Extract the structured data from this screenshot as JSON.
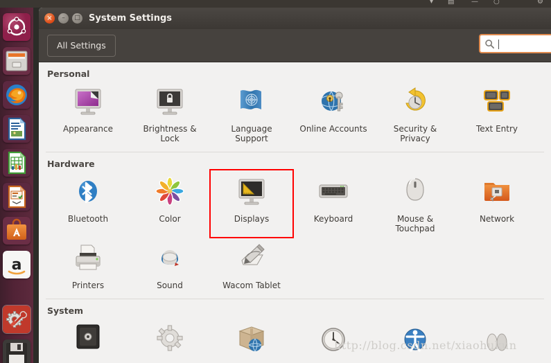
{
  "top_panel": {
    "indicators": [
      "chevron-down",
      "battery",
      "keyboard-layout",
      "clock",
      "power-gear"
    ]
  },
  "launcher": {
    "items": [
      {
        "name": "ubuntu-dash",
        "label": "Ubuntu Dash",
        "active": false
      },
      {
        "name": "files",
        "label": "Files",
        "active": false
      },
      {
        "name": "firefox",
        "label": "Firefox Web Browser",
        "active": false
      },
      {
        "name": "libreoffice-writer",
        "label": "LibreOffice Writer",
        "active": false
      },
      {
        "name": "libreoffice-calc",
        "label": "LibreOffice Calc",
        "active": false
      },
      {
        "name": "libreoffice-impress",
        "label": "LibreOffice Impress",
        "active": false
      },
      {
        "name": "ubuntu-software-center",
        "label": "Ubuntu Software Center",
        "active": false
      },
      {
        "name": "amazon",
        "label": "Amazon",
        "active": false
      },
      {
        "name": "system-settings",
        "label": "System Settings",
        "active": true
      },
      {
        "name": "disk-drive",
        "label": "Disk",
        "active": false
      }
    ]
  },
  "window": {
    "title": "System Settings",
    "controls": {
      "close": "×",
      "minimize": "–",
      "maximize": "□"
    },
    "toolbar": {
      "all_settings_label": "All Settings",
      "search_value": "",
      "search_placeholder": ""
    }
  },
  "sections": [
    {
      "title": "Personal",
      "items": [
        {
          "label": "Appearance",
          "icon": "appearance-icon",
          "highlight": false
        },
        {
          "label": "Brightness & Lock",
          "icon": "brightness-lock-icon",
          "highlight": false
        },
        {
          "label": "Language Support",
          "icon": "language-support-icon",
          "highlight": false
        },
        {
          "label": "Online Accounts",
          "icon": "online-accounts-icon",
          "highlight": false
        },
        {
          "label": "Security & Privacy",
          "icon": "security-privacy-icon",
          "highlight": false
        },
        {
          "label": "Text Entry",
          "icon": "text-entry-icon",
          "highlight": false
        }
      ]
    },
    {
      "title": "Hardware",
      "items": [
        {
          "label": "Bluetooth",
          "icon": "bluetooth-icon",
          "highlight": false
        },
        {
          "label": "Color",
          "icon": "color-icon",
          "highlight": false
        },
        {
          "label": "Displays",
          "icon": "displays-icon",
          "highlight": true
        },
        {
          "label": "Keyboard",
          "icon": "keyboard-icon",
          "highlight": false
        },
        {
          "label": "Mouse & Touchpad",
          "icon": "mouse-touchpad-icon",
          "highlight": false
        },
        {
          "label": "Network",
          "icon": "network-icon",
          "highlight": false
        },
        {
          "label": "Printers",
          "icon": "printers-icon",
          "highlight": false
        },
        {
          "label": "Sound",
          "icon": "sound-icon",
          "highlight": false
        },
        {
          "label": "Wacom Tablet",
          "icon": "wacom-tablet-icon",
          "highlight": false
        }
      ]
    },
    {
      "title": "System",
      "items": [
        {
          "label": "",
          "icon": "backups-icon",
          "highlight": false
        },
        {
          "label": "",
          "icon": "details-icon",
          "highlight": false
        },
        {
          "label": "",
          "icon": "software-updates-icon",
          "highlight": false
        },
        {
          "label": "",
          "icon": "time-date-icon",
          "highlight": false
        },
        {
          "label": "",
          "icon": "universal-access-icon",
          "highlight": false
        },
        {
          "label": "",
          "icon": "user-accounts-icon",
          "highlight": false
        }
      ]
    }
  ],
  "watermark": {
    "text": "http://blog.csdn.net/xiaohukun"
  }
}
